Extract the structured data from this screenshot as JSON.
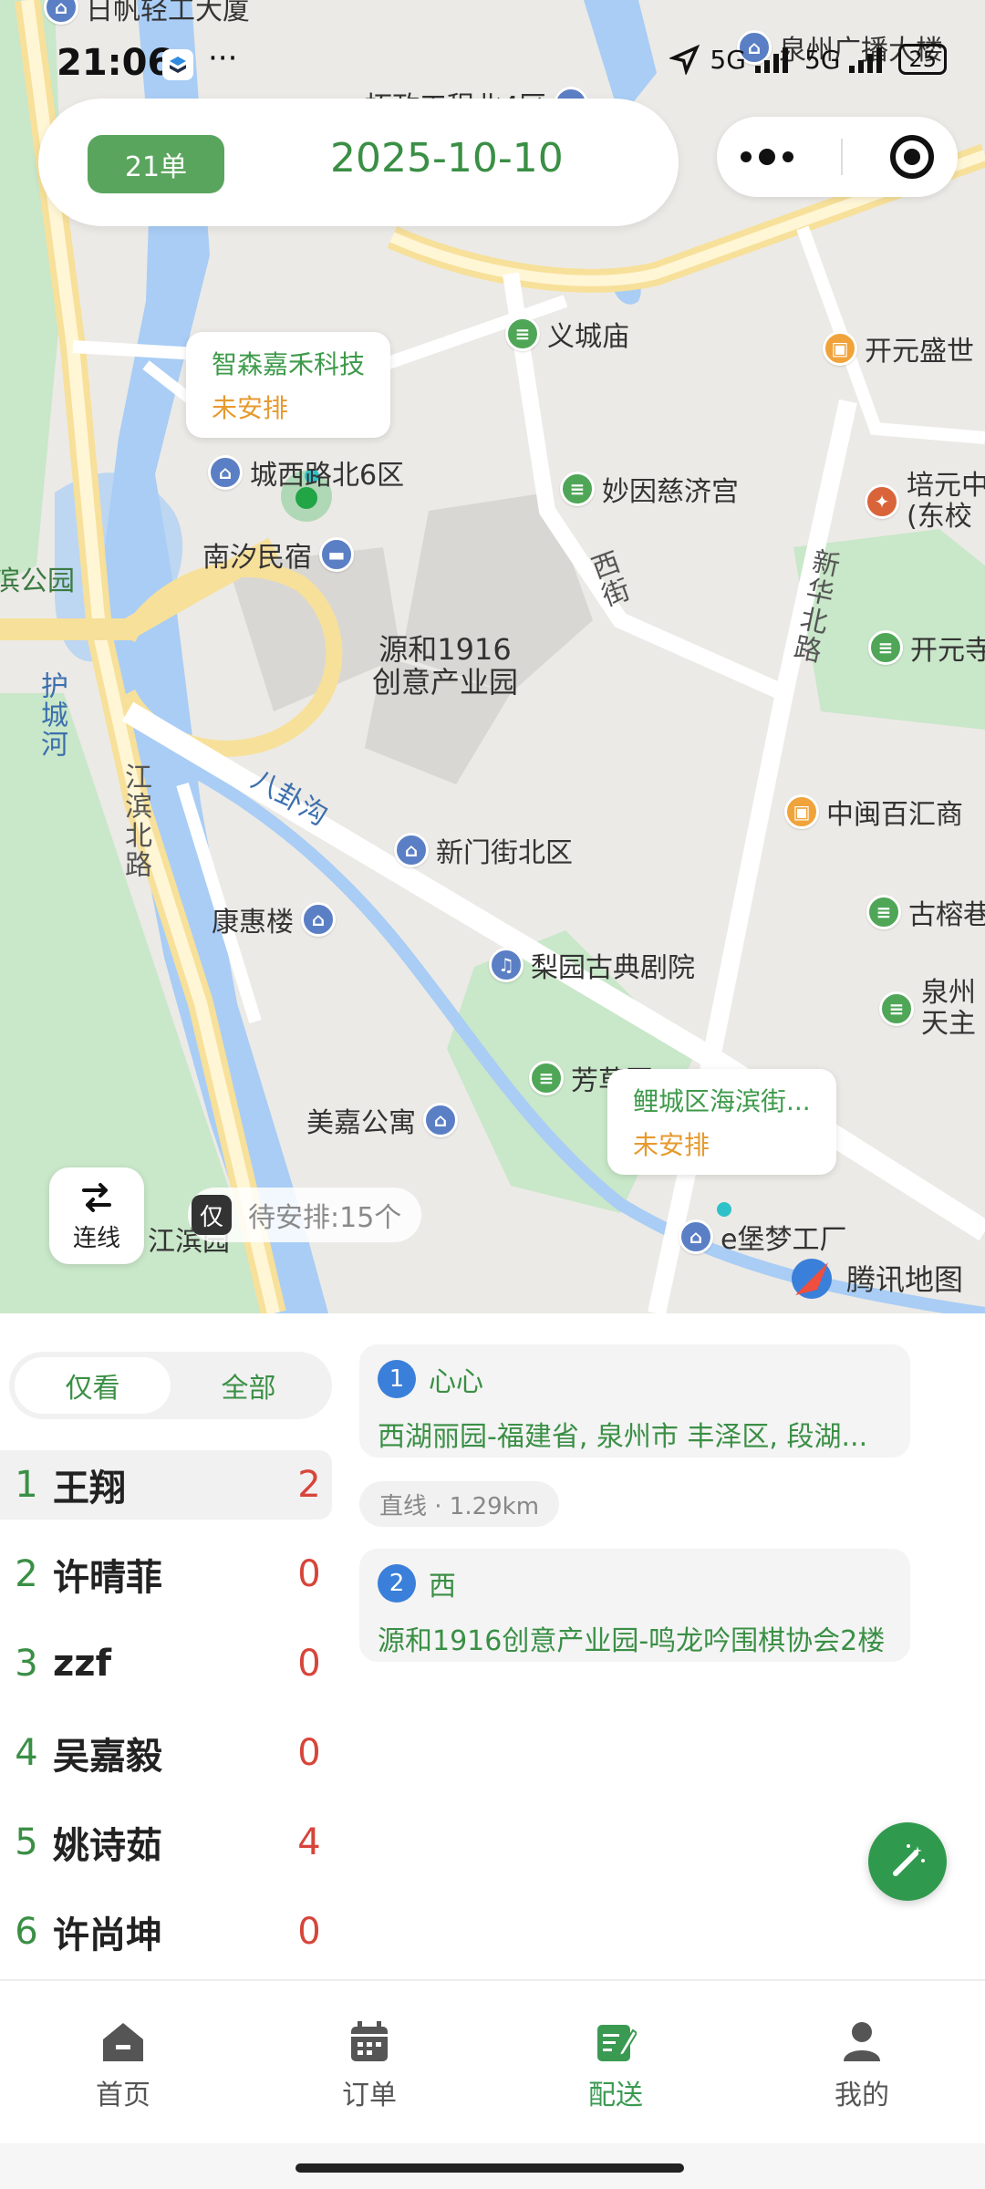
{
  "status_bar": {
    "time": "21:06",
    "network": "5G",
    "network2": "5G",
    "battery": "25"
  },
  "header": {
    "order_count": "21单",
    "date": "2025-10-10"
  },
  "map": {
    "pois": [
      {
        "label": "日帆轻工大厦",
        "kind": "blue"
      },
      {
        "label": "泉州广播大楼",
        "kind": "blue"
      },
      {
        "label": "拓政工程北4区",
        "kind": "blue"
      },
      {
        "label": "义城庙",
        "kind": "green"
      },
      {
        "label": "开元盛世",
        "kind": "orange"
      },
      {
        "label": "城西路北6区",
        "kind": "blue"
      },
      {
        "label": "南汐民宿",
        "kind": "blue"
      },
      {
        "label": "妙因慈济宫",
        "kind": "green"
      },
      {
        "label": "培元中\n(东校",
        "kind": "red"
      },
      {
        "label": "源和1916\n创意产业园",
        "kind": "none"
      },
      {
        "label": "开元寺",
        "kind": "green"
      },
      {
        "label": "中闽百汇商",
        "kind": "orange"
      },
      {
        "label": "新门街北区",
        "kind": "blue"
      },
      {
        "label": "康惠楼",
        "kind": "blue"
      },
      {
        "label": "古榕巷",
        "kind": "green"
      },
      {
        "label": "梨园古典剧院",
        "kind": "blue"
      },
      {
        "label": "泉州\n天主",
        "kind": "green"
      },
      {
        "label": "芳草园",
        "kind": "green"
      },
      {
        "label": "美嘉公寓",
        "kind": "blue"
      },
      {
        "label": "e堡梦工厂",
        "kind": "blue"
      },
      {
        "label": "江滨园",
        "kind": "green"
      }
    ],
    "roads": [
      "西街",
      "新华北路",
      "八卦沟",
      "江滨北路",
      "护城河",
      "滨公园"
    ],
    "tags": [
      {
        "name": "智森嘉禾科技",
        "status": "未安排"
      },
      {
        "name": "鲤城区海滨街...",
        "status": "未安排"
      }
    ],
    "connect_label": "连线",
    "only_label": "仅",
    "pending_label": "待安排:15个",
    "brand": "腾讯地图"
  },
  "filter": {
    "only": "仅看",
    "all": "全部"
  },
  "drivers": [
    {
      "index": "1",
      "name": "王翔",
      "count": "2"
    },
    {
      "index": "2",
      "name": "许晴菲",
      "count": "0"
    },
    {
      "index": "3",
      "name": "zzf",
      "count": "0"
    },
    {
      "index": "4",
      "name": "吴嘉毅",
      "count": "0"
    },
    {
      "index": "5",
      "name": "姚诗茹",
      "count": "4"
    },
    {
      "index": "6",
      "name": "许尚坤",
      "count": "0"
    }
  ],
  "stops": [
    {
      "num": "1",
      "name": "心心",
      "address": "西湖丽园-福建省, 泉州市 丰泽区, 段湖..."
    },
    {
      "num": "2",
      "name": "西",
      "address": "源和1916创意产业园-鸣龙吟围棋协会2楼"
    }
  ],
  "distance": "直线 · 1.29km",
  "tabs": [
    {
      "label": "首页",
      "icon": "home-icon"
    },
    {
      "label": "订单",
      "icon": "calendar-icon"
    },
    {
      "label": "配送",
      "icon": "edit-note-icon"
    },
    {
      "label": "我的",
      "icon": "person-icon"
    }
  ],
  "colors": {
    "primary_green": "#3a8f45",
    "badge_green": "#5aa55e",
    "alert_red": "#d7453a",
    "pending_orange": "#e69a2f",
    "stop_blue": "#3a7fd9"
  }
}
